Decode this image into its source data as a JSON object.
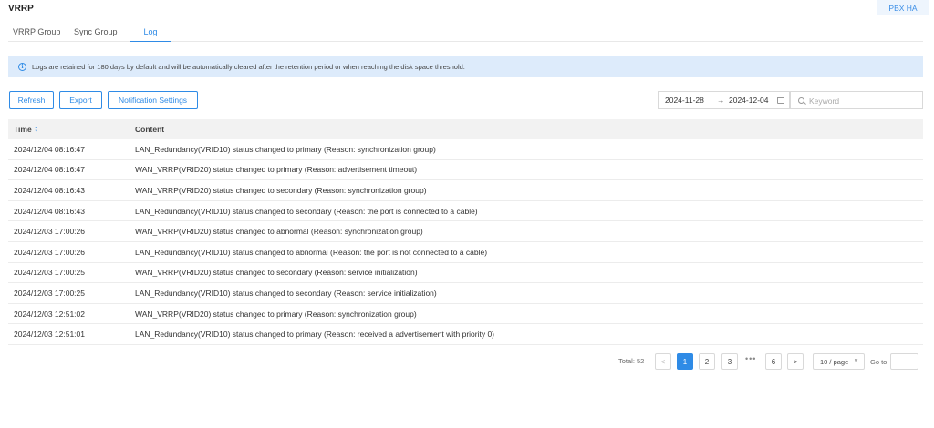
{
  "header": {
    "title": "VRRP",
    "top_right_button": "PBX HA"
  },
  "tabs": [
    {
      "label": "VRRP Group"
    },
    {
      "label": "Sync Group"
    },
    {
      "label": "Log"
    }
  ],
  "banner": {
    "icon": "info-icon",
    "text": "Logs are retained for 180 days by default and will be automatically cleared after the retention period or when reaching the disk space threshold."
  },
  "toolbar": {
    "refresh_label": "Refresh",
    "export_label": "Export",
    "notification_label": "Notification Settings",
    "date_start": "2024-11-28",
    "date_arrow": "→",
    "date_end": "2024-12-04",
    "search_placeholder": "Keyword"
  },
  "table": {
    "headers": {
      "time": "Time",
      "content": "Content"
    },
    "rows": [
      {
        "time": "2024/12/04 08:16:47",
        "content": "LAN_Redundancy(VRID10) status changed to primary (Reason: synchronization group)"
      },
      {
        "time": "2024/12/04 08:16:47",
        "content": "WAN_VRRP(VRID20) status changed to primary (Reason: advertisement timeout)"
      },
      {
        "time": "2024/12/04 08:16:43",
        "content": "WAN_VRRP(VRID20) status changed to secondary (Reason: synchronization group)"
      },
      {
        "time": "2024/12/04 08:16:43",
        "content": "LAN_Redundancy(VRID10) status changed to secondary (Reason: the port is connected to a cable)"
      },
      {
        "time": "2024/12/03 17:00:26",
        "content": "WAN_VRRP(VRID20) status changed to abnormal (Reason: synchronization group)"
      },
      {
        "time": "2024/12/03 17:00:26",
        "content": "LAN_Redundancy(VRID10) status changed to abnormal (Reason: the port is not connected to a cable)"
      },
      {
        "time": "2024/12/03 17:00:25",
        "content": "WAN_VRRP(VRID20) status changed to secondary (Reason: service initialization)"
      },
      {
        "time": "2024/12/03 17:00:25",
        "content": "LAN_Redundancy(VRID10) status changed to secondary (Reason: service initialization)"
      },
      {
        "time": "2024/12/03 12:51:02",
        "content": "WAN_VRRP(VRID20) status changed to primary (Reason: synchronization group)"
      },
      {
        "time": "2024/12/03 12:51:01",
        "content": "LAN_Redundancy(VRID10) status changed to primary (Reason: received a advertisement with priority 0)"
      }
    ]
  },
  "pagination": {
    "total_label": "Total: 52",
    "prev": "<",
    "pages": [
      "1",
      "2",
      "3",
      "6"
    ],
    "ellipsis": "•••",
    "next": ">",
    "page_size": "10 / page",
    "goto_label": "Go to",
    "current_page": "1"
  },
  "colors": {
    "accent": "#2f8be6",
    "banner_bg": "#ddebfb",
    "header_bg": "#f2f2f2"
  }
}
